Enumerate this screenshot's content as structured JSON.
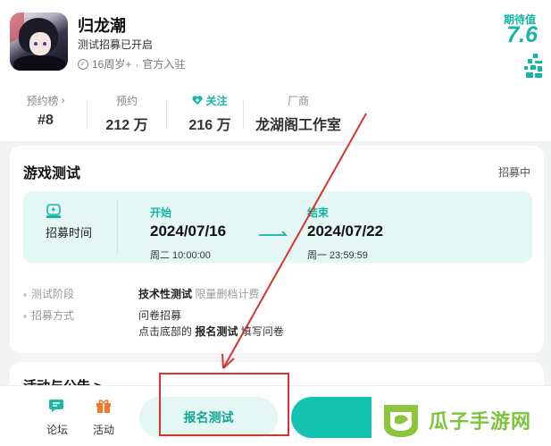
{
  "game": {
    "title": "归龙潮",
    "test_status": "测试招募已开启",
    "age_rating": "16周岁+",
    "separator": "·",
    "official": "官方入驻"
  },
  "expectation": {
    "label": "期待值",
    "score": "7.6"
  },
  "stats": [
    {
      "label": "预约榜",
      "value": "#8",
      "has_chevron": true
    },
    {
      "label": "预约",
      "value": "212 万"
    },
    {
      "label": "关注",
      "value": "216 万",
      "icon": "heart-plus-icon"
    },
    {
      "label": "厂商",
      "value": "龙湖阁工作室"
    }
  ],
  "test_card": {
    "title": "游戏测试",
    "status": "招募中",
    "recruit_time_label": "招募时间",
    "start": {
      "tag": "开始",
      "date": "2024/07/16",
      "sub": "周二 10:00:00"
    },
    "end": {
      "tag": "结束",
      "date": "2024/07/22",
      "sub": "周一 23:59:59"
    },
    "phase_label": "测试阶段",
    "phase_value": "技术性测试",
    "phase_extra": "限量删档计费",
    "method_label": "招募方式",
    "method_line1": "问卷招募",
    "method_line2_prefix": "点击底部的",
    "method_line2_bold": "报名测试",
    "method_line2_suffix": "填写问卷"
  },
  "announcement_card": {
    "title": "活动与公告 >"
  },
  "bottom_bar": {
    "forum_label": "论坛",
    "activity_label": "活动",
    "signup_label": "报名测试"
  },
  "watermark": {
    "text": "瓜子手游网"
  },
  "colors": {
    "accent": "#12b5a6",
    "highlight": "#d8342c",
    "watermark": "#7cc43a"
  }
}
